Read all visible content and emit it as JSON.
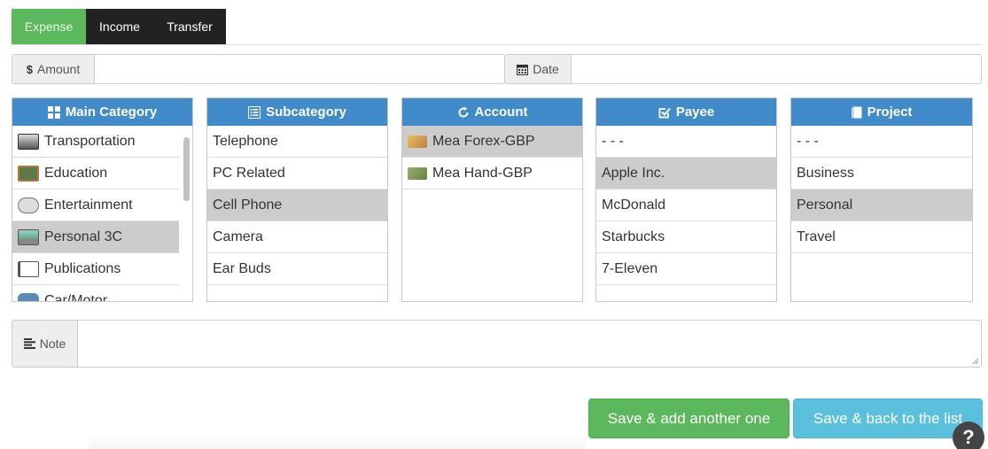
{
  "tabs": [
    {
      "label": "Expense",
      "active": true
    },
    {
      "label": "Income",
      "active": false
    },
    {
      "label": "Transfer",
      "active": false
    }
  ],
  "amount": {
    "label": "Amount",
    "icon": "dollar-icon",
    "value": ""
  },
  "date": {
    "label": "Date",
    "icon": "calendar-icon",
    "value": ""
  },
  "panels": {
    "main_category": {
      "title": "Main Category",
      "icon": "grid-icon",
      "items": [
        "Transportation",
        "Education",
        "Entertainment",
        "Personal 3C",
        "Publications",
        "Car/Motor"
      ],
      "selected": 3
    },
    "subcategory": {
      "title": "Subcategory",
      "icon": "list-icon",
      "items": [
        "Telephone",
        "PC Related",
        "Cell Phone",
        "Camera",
        "Ear Buds"
      ],
      "selected": 2
    },
    "account": {
      "title": "Account",
      "icon": "refresh-icon",
      "items": [
        "Mea Forex-GBP",
        "Mea Hand-GBP"
      ],
      "selected": 0
    },
    "payee": {
      "title": "Payee",
      "icon": "check-icon",
      "items": [
        "- - -",
        "Apple Inc.",
        "McDonald",
        "Starbucks",
        "7-Eleven"
      ],
      "selected": 1
    },
    "project": {
      "title": "Project",
      "icon": "book-icon",
      "items": [
        "- - -",
        "Business",
        "Personal",
        "Travel"
      ],
      "selected": 2
    }
  },
  "note": {
    "label": "Note",
    "icon": "align-left-icon",
    "value": ""
  },
  "buttons": {
    "save_add": "Save & add another one",
    "save_back": "Save & back to the list"
  },
  "help": {
    "label": "?"
  },
  "colors": {
    "green": "#5cb85c",
    "blue_header": "#428bca",
    "light_blue": "#5bc0de",
    "selected_row": "#cccccc"
  }
}
